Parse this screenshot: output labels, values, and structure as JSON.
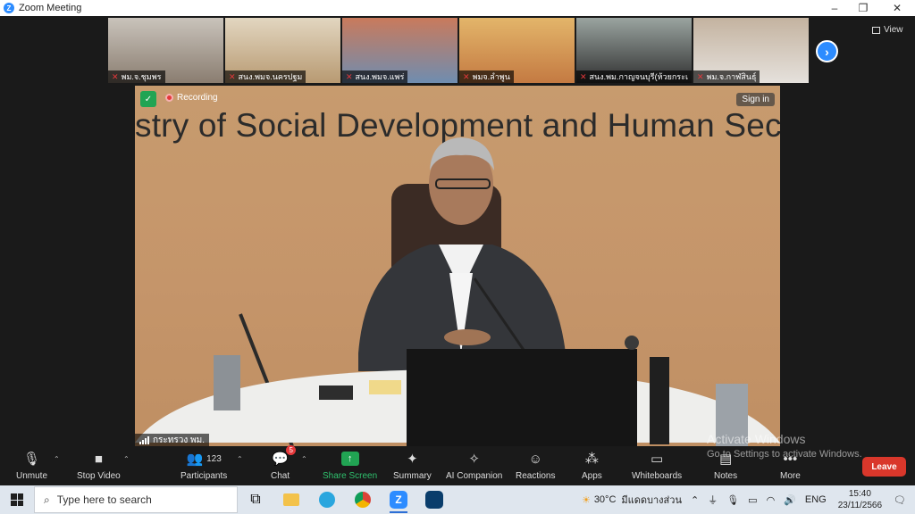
{
  "window": {
    "title": "Zoom Meeting"
  },
  "participant_tiles": [
    {
      "name": "พม.จ.ชุมพร",
      "scene": [
        "#8a7d70",
        "#c9c3bb"
      ]
    },
    {
      "name": "สนง.พมจ.นครปฐม",
      "scene": [
        "#b89a72",
        "#e2d6c0"
      ]
    },
    {
      "name": "สนง.พมจ.แพร่",
      "scene": [
        "#6f8db0",
        "#c97a5c"
      ]
    },
    {
      "name": "พมจ.ลำพูน",
      "scene": [
        "#c47a42",
        "#e3b56a"
      ]
    },
    {
      "name": "สนง.พม.กาญจนบุรี(ห้วยกระเจา)",
      "scene": [
        "#303030",
        "#9aa4a0"
      ]
    },
    {
      "name": "พม.จ.กาฬสินธุ์",
      "scene": [
        "#e5e1dc",
        "#c4b3a0"
      ]
    }
  ],
  "view": {
    "label": "View"
  },
  "main_video": {
    "wall_text": "stry of Social Development and Human Secu",
    "recording_label": "Recording",
    "signin_label": "Sign in",
    "speaker_name": "กระทรวง พม."
  },
  "watermark": {
    "line1": "Activate Windows",
    "line2": "Go to Settings to activate Windows."
  },
  "toolbar": {
    "unmute": "Unmute",
    "stop_video": "Stop Video",
    "participants": "Participants",
    "participants_count": "123",
    "chat": "Chat",
    "chat_badge": "5",
    "share_screen": "Share Screen",
    "summary": "Summary",
    "ai_companion": "AI Companion",
    "reactions": "Reactions",
    "apps": "Apps",
    "whiteboards": "Whiteboards",
    "notes": "Notes",
    "more": "More",
    "leave": "Leave"
  },
  "taskbar": {
    "search_placeholder": "Type here to search",
    "weather": "30°C",
    "weather_place": "มีแดดบางส่วน",
    "language": "ENG",
    "time": "15:40",
    "date": "23/11/2566"
  },
  "colors": {
    "zoom_blue": "#2d8cff",
    "leave_red": "#d9372b",
    "share_green": "#21a453"
  }
}
